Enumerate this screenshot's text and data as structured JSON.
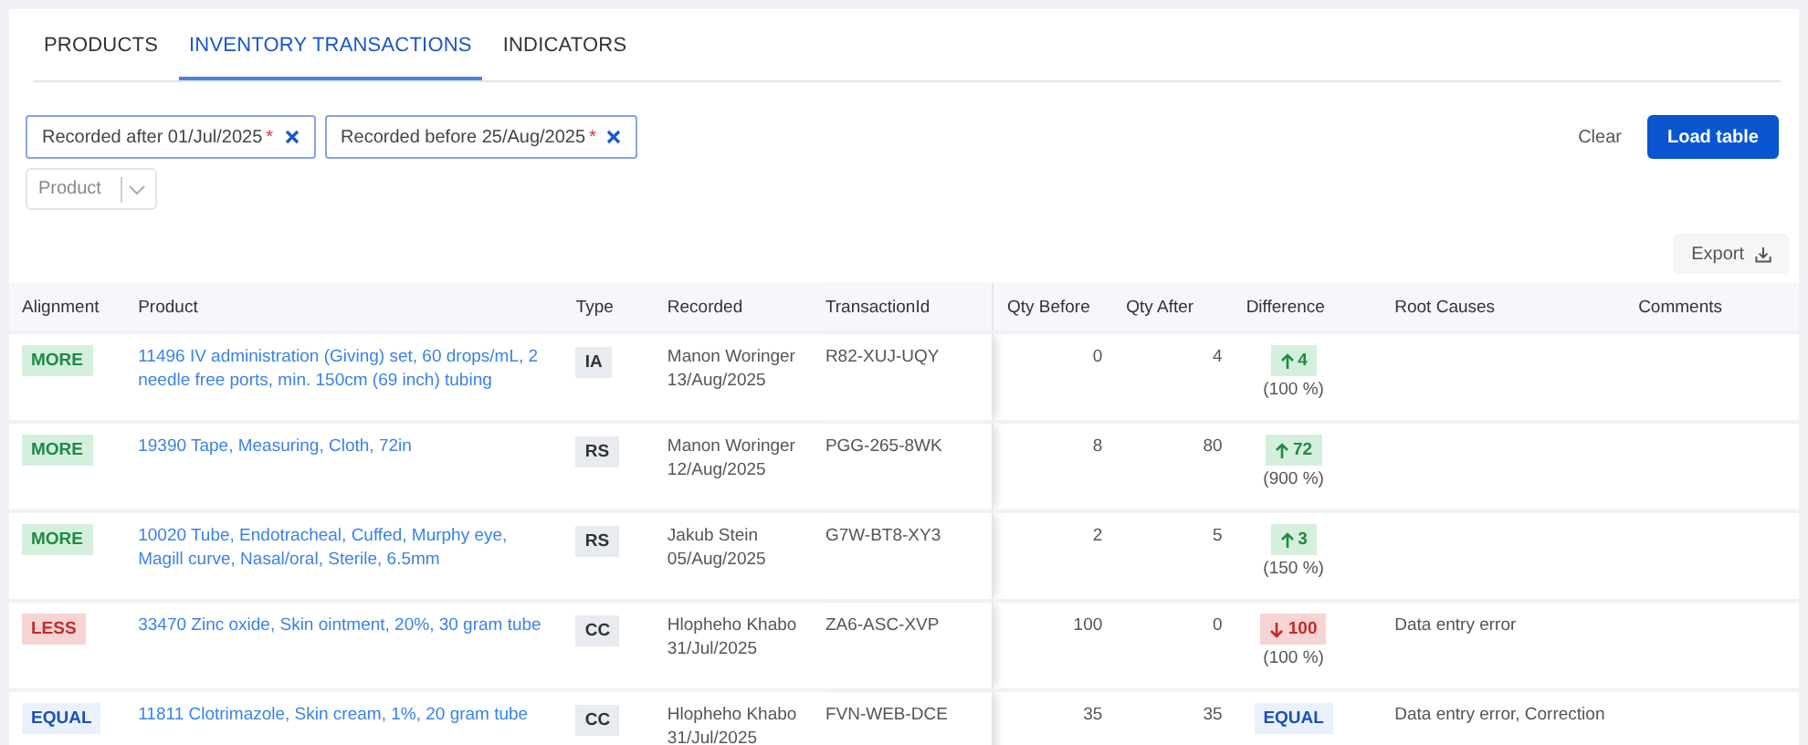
{
  "tabs": [
    {
      "label": "PRODUCTS",
      "selected": false
    },
    {
      "label": "INVENTORY TRANSACTIONS",
      "selected": true
    },
    {
      "label": "INDICATORS",
      "selected": false
    }
  ],
  "filters": [
    {
      "label": "Recorded after 01/Jul/2025",
      "marker": "*"
    },
    {
      "label": "Recorded before 25/Aug/2025",
      "marker": "*"
    }
  ],
  "product_select": {
    "placeholder": "Product"
  },
  "actions": {
    "clear": "Clear",
    "load": "Load table",
    "export": "Export"
  },
  "table": {
    "columns": [
      "Alignment",
      "Product",
      "Type",
      "Recorded",
      "TransactionId",
      "Qty Before",
      "Qty After",
      "Difference",
      "Root Causes",
      "Comments"
    ],
    "rows": [
      {
        "alignment": {
          "label": "MORE",
          "kind": "more"
        },
        "product": "11496 IV administration (Giving) set, 60 drops/mL, 2 needle free ports, min. 150cm (69 inch) tubing",
        "type": "IA",
        "recorded_by": "Manon Woringer",
        "recorded_on": "13/Aug/2025",
        "transaction_id": "R82-XUJ-UQY",
        "qty_before": "0",
        "qty_after": "4",
        "difference": {
          "kind": "up",
          "value": "4",
          "percent": "(100 %)"
        }
      },
      {
        "alignment": {
          "label": "MORE",
          "kind": "more"
        },
        "product": "19390 Tape, Measuring, Cloth, 72in",
        "type": "RS",
        "recorded_by": "Manon Woringer",
        "recorded_on": "12/Aug/2025",
        "transaction_id": "PGG-265-8WK",
        "qty_before": "8",
        "qty_after": "80",
        "difference": {
          "kind": "up",
          "value": "72",
          "percent": "(900 %)"
        }
      },
      {
        "alignment": {
          "label": "MORE",
          "kind": "more"
        },
        "product": "10020 Tube, Endotracheal, Cuffed, Murphy eye, Magill curve, Nasal/oral, Sterile, 6.5mm",
        "type": "RS",
        "recorded_by": "Jakub Stein",
        "recorded_on": "05/Aug/2025",
        "transaction_id": "G7W-BT8-XY3",
        "qty_before": "2",
        "qty_after": "5",
        "difference": {
          "kind": "up",
          "value": "3",
          "percent": "(150 %)"
        }
      },
      {
        "alignment": {
          "label": "LESS",
          "kind": "less"
        },
        "product": "33470 Zinc oxide, Skin ointment, 20%, 30 gram tube",
        "type": "CC",
        "recorded_by": "Hlopheho Khabo",
        "recorded_on": "31/Jul/2025",
        "transaction_id": "ZA6-ASC-XVP",
        "qty_before": "100",
        "qty_after": "0",
        "difference": {
          "kind": "down",
          "value": "100",
          "percent": "(100 %)"
        },
        "root_causes": "Data entry error"
      },
      {
        "alignment": {
          "label": "EQUAL",
          "kind": "equal"
        },
        "product": "11811 Clotrimazole, Skin cream, 1%, 20 gram tube",
        "type": "CC",
        "recorded_by": "Hlopheho Khabo",
        "recorded_on": "31/Jul/2025",
        "transaction_id": "FVN-WEB-DCE",
        "qty_before": "35",
        "qty_after": "35",
        "difference": {
          "kind": "equal",
          "value": "EQUAL"
        },
        "root_causes": "Data entry error, Correction"
      }
    ]
  }
}
